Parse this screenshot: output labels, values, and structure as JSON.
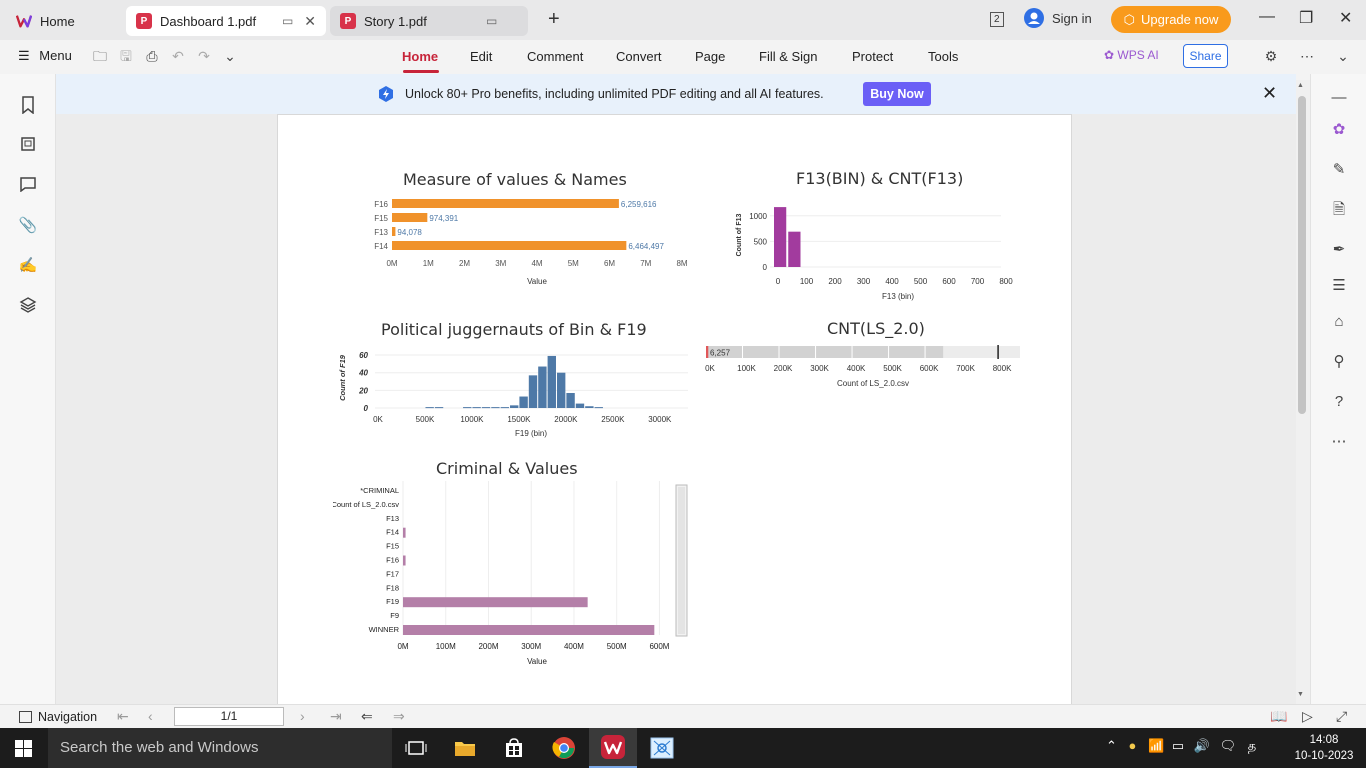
{
  "tabs": {
    "home": "Home",
    "dashboard": "Dashboard 1.pdf",
    "story": "Story 1.pdf"
  },
  "header": {
    "page_badge": "2",
    "signin": "Sign in",
    "upgrade": "Upgrade now"
  },
  "menubar": {
    "menu": "Menu",
    "tabs": [
      "Home",
      "Edit",
      "Comment",
      "Convert",
      "Page",
      "Fill & Sign",
      "Protect",
      "Tools"
    ],
    "wps_ai": "WPS AI",
    "share": "Share"
  },
  "banner": {
    "text": "Unlock 80+ Pro benefits, including unlimited PDF editing and all AI features.",
    "button": "Buy Now"
  },
  "status": {
    "navigation": "Navigation",
    "page": "1/1"
  },
  "taskbar": {
    "search": "Search the web and Windows",
    "time": "14:08",
    "date": "10-10-2023"
  },
  "colors": {
    "accent": "#c7243a",
    "orange": "#f0922b",
    "purple": "#a23b9e",
    "blue": "#4e79a7",
    "mauve": "#b47fa8",
    "upgrade": "#f99a1c",
    "buy": "#6b5ff6"
  },
  "chart_data": [
    {
      "type": "bar",
      "orientation": "horizontal",
      "title": "Measure of values & Names",
      "categories": [
        "F16",
        "F15",
        "F13",
        "F14"
      ],
      "values": [
        6259616,
        974391,
        94078,
        6464497
      ],
      "value_labels": [
        "6,259,616",
        "974,391",
        "94,078",
        "6,464,497"
      ],
      "xlabel": "Value",
      "xticks": [
        "0M",
        "1M",
        "2M",
        "3M",
        "4M",
        "5M",
        "6M",
        "7M",
        "8M"
      ],
      "xlim": [
        0,
        8000000
      ]
    },
    {
      "type": "bar",
      "title": "F13(BIN) & CNT(F13)",
      "x": [
        0,
        50
      ],
      "bin_width": 50,
      "values": [
        1170,
        690
      ],
      "xlabel": "F13 (bin)",
      "ylabel": "Count of F13",
      "xticks": [
        "0",
        "100",
        "200",
        "300",
        "400",
        "500",
        "600",
        "700",
        "800",
        "900"
      ],
      "yticks": [
        "0",
        "500",
        "1000"
      ],
      "xlim": [
        0,
        950
      ],
      "ylim": [
        0,
        1250
      ]
    },
    {
      "type": "bar",
      "title": "Political juggernauts of Bin & F19",
      "x": [
        500,
        600,
        900,
        1000,
        1100,
        1200,
        1300,
        1400,
        1500,
        1600,
        1700,
        1800,
        1900,
        2000,
        2100,
        2200,
        2300
      ],
      "bin_width": 100,
      "values": [
        1,
        1,
        1,
        1,
        1,
        1,
        1,
        3,
        13,
        37,
        47,
        59,
        40,
        17,
        5,
        2,
        1
      ],
      "xlabel": "F19 (bin)",
      "ylabel": "Count of F19",
      "xticks": [
        "0K",
        "500K",
        "1000K",
        "1500K",
        "2000K",
        "2500K",
        "3000K"
      ],
      "yticks": [
        "0",
        "20",
        "40",
        "60"
      ],
      "xlim": [
        0,
        3300
      ],
      "ylim": [
        0,
        68
      ]
    },
    {
      "type": "bar",
      "orientation": "horizontal",
      "title": "CNT(LS_2.0)",
      "categories": [
        "LS_2.0"
      ],
      "values": [
        6257
      ],
      "value_labels": [
        "6,257"
      ],
      "xlabel": "Count of LS_2.0.csv",
      "xticks": [
        "0K",
        "100K",
        "200K",
        "300K",
        "400K",
        "500K",
        "600K",
        "700K",
        "800K"
      ],
      "xlim": [
        0,
        860000
      ]
    },
    {
      "type": "bar",
      "orientation": "horizontal",
      "title": "Criminal & Values",
      "categories": [
        "*CRIMINAL",
        "Count of LS_2.0.csv",
        "F13",
        "F14",
        "F15",
        "F16",
        "F17",
        "F18",
        "F19",
        "F9",
        "WINNER"
      ],
      "values": [
        0,
        0,
        0,
        6000000,
        0,
        6000000,
        0,
        0,
        432000000,
        0,
        588000000
      ],
      "xlabel": "Value",
      "xticks": [
        "0M",
        "100M",
        "200M",
        "300M",
        "400M",
        "500M",
        "600M"
      ],
      "xlim": [
        0,
        620000000
      ]
    }
  ]
}
